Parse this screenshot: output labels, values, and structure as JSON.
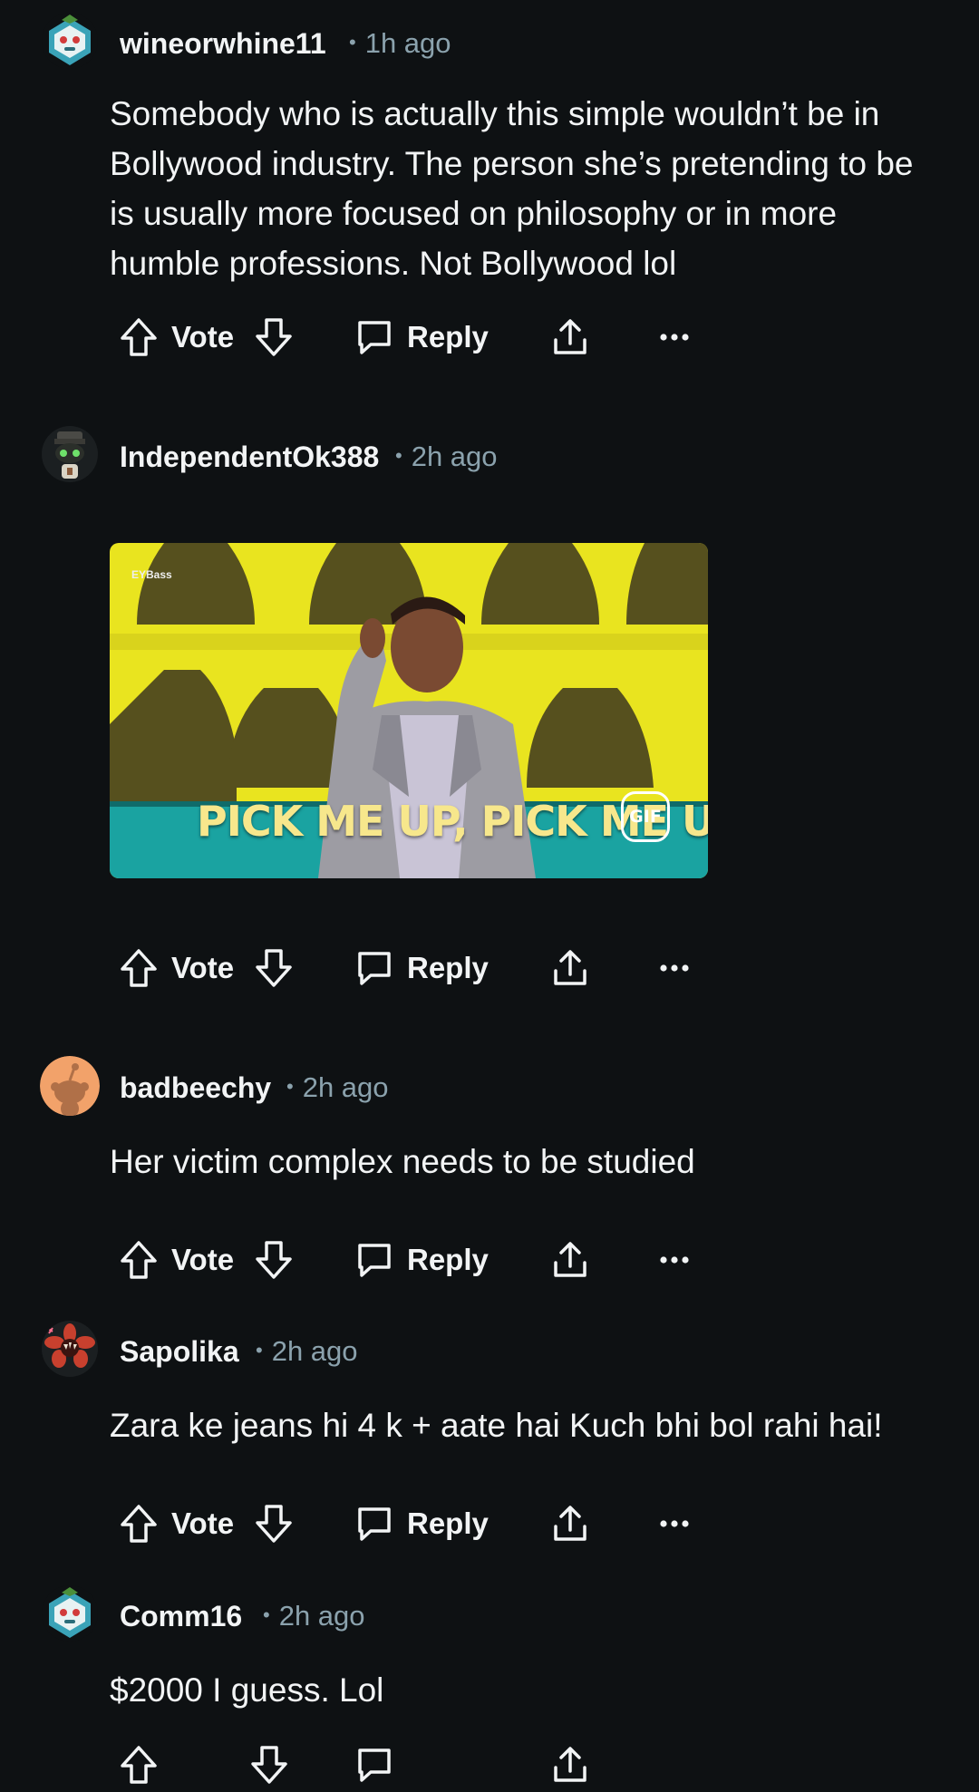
{
  "comments": [
    {
      "username": "wineorwhine11",
      "time": "1h ago",
      "body": "Somebody who is actually this simple wouldn’t be in Bollywood industry. The person she’s pretending to be is usually more focused on philosophy or in more humble professions. Not Bollywood lol"
    },
    {
      "username": "IndependentOk388",
      "time": "2h ago",
      "media": {
        "caption": "PICK ME UP, PICK ME UP",
        "badge": "GIF",
        "logo_text": "EYBass",
        "colors": {
          "background": "#e9e41f",
          "floor": "#1aa3a1"
        }
      }
    },
    {
      "username": "badbeechy",
      "time": "2h ago",
      "body": "Her victim complex needs to be studied"
    },
    {
      "username": "Sapolika",
      "time": "2h ago",
      "body": "Zara ke jeans hi 4 k + aate hai Kuch bhi bol rahi hai!"
    },
    {
      "username": "Comm16",
      "time": "2h ago",
      "body": "$2000 I guess. Lol"
    }
  ],
  "actions": {
    "vote_label": "Vote",
    "reply_label": "Reply",
    "icons": [
      "upvote-icon",
      "downvote-icon",
      "reply-icon",
      "share-icon",
      "more-icon"
    ]
  },
  "theme": {
    "background": "#0e1113",
    "text": "#f2f4f5",
    "muted": "#8ba2ad"
  }
}
